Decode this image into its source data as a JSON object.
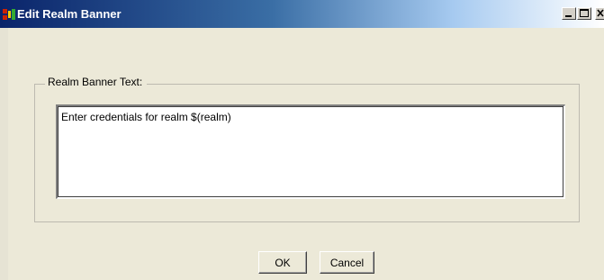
{
  "window": {
    "title": "Edit Realm Banner",
    "app_icon": "app-icon",
    "controls": {
      "minimize_icon": "minimize-icon",
      "maximize_icon": "maximize-icon",
      "close_icon": "close-icon"
    }
  },
  "group": {
    "label": "Realm Banner Text:"
  },
  "banner_text": {
    "value": "Enter credentials for realm $(realm)"
  },
  "buttons": {
    "ok_label": "OK",
    "cancel_label": "Cancel"
  },
  "colors": {
    "titlebar_start": "#0a246a",
    "titlebar_end": "#ffffff",
    "dialog_bg": "#ece9d8"
  }
}
